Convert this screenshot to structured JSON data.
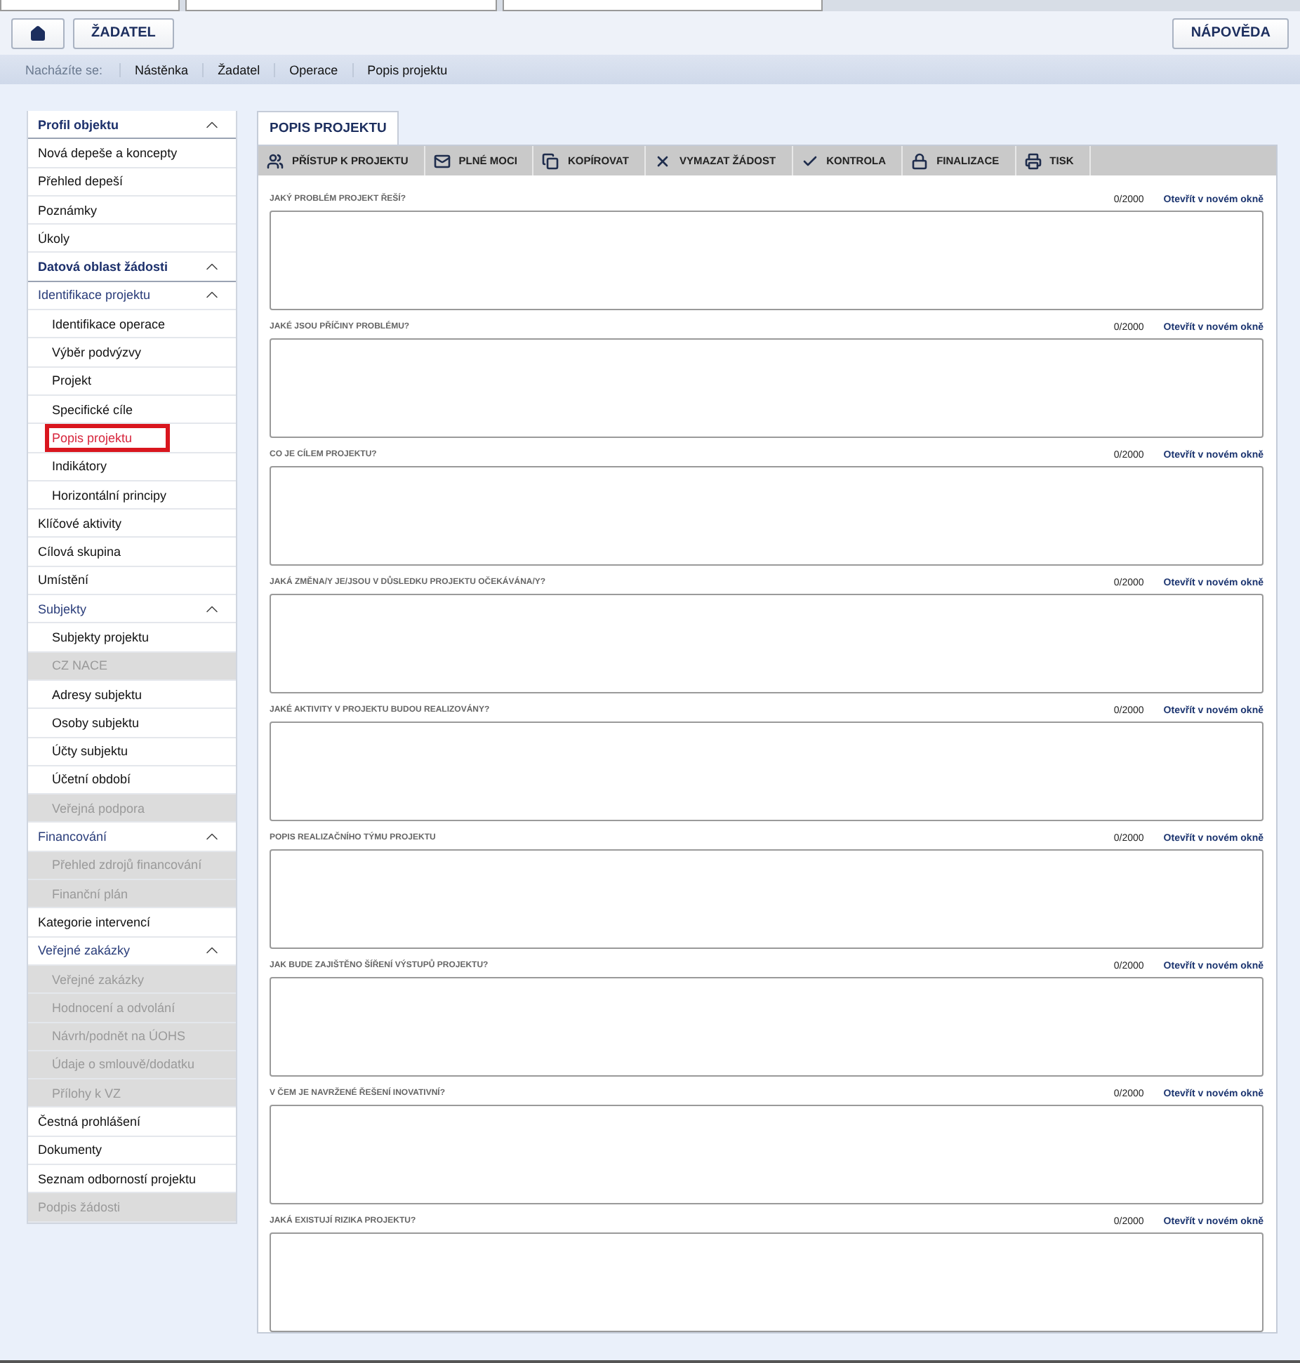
{
  "header": {
    "buttons": [
      {
        "label": "ŽADATEL"
      }
    ],
    "help_button": "NÁPOVĚDA"
  },
  "breadcrumb": {
    "prefix": "Nacházíte se:",
    "items": [
      "Nástěnka",
      "Žadatel",
      "Operace",
      "Popis projektu"
    ]
  },
  "sidebar": {
    "items": [
      {
        "kind": "section",
        "label": "Profil objektu",
        "expanded": true,
        "selected": false,
        "disabled": false,
        "children": [
          {
            "kind": "item",
            "label": "Nová depeše a koncepty",
            "selected": false,
            "disabled": false
          },
          {
            "kind": "item",
            "label": "Přehled depeší",
            "selected": false,
            "disabled": false
          },
          {
            "kind": "item",
            "label": "Poznámky",
            "selected": false,
            "disabled": false
          },
          {
            "kind": "item",
            "label": "Úkoly",
            "selected": false,
            "disabled": false
          }
        ]
      },
      {
        "kind": "section",
        "label": "Datová oblast žádosti",
        "expanded": true,
        "selected": false,
        "disabled": false,
        "children": [
          {
            "kind": "group",
            "label": "Identifikace projektu",
            "expanded": true,
            "selected": false,
            "disabled": false,
            "children": [
              {
                "kind": "item",
                "label": "Identifikace operace",
                "selected": false,
                "disabled": false
              },
              {
                "kind": "item",
                "label": "Výběr podvýzvy",
                "selected": false,
                "disabled": false
              },
              {
                "kind": "item",
                "label": "Projekt",
                "selected": false,
                "disabled": false
              },
              {
                "kind": "item",
                "label": "Specifické cíle",
                "selected": false,
                "disabled": false
              },
              {
                "kind": "item",
                "label": "Popis projektu",
                "selected": true,
                "disabled": false
              },
              {
                "kind": "item",
                "label": "Indikátory",
                "selected": false,
                "disabled": false
              },
              {
                "kind": "item",
                "label": "Horizontální principy",
                "selected": false,
                "disabled": false
              }
            ]
          },
          {
            "kind": "item",
            "label": "Klíčové aktivity",
            "selected": false,
            "disabled": false
          },
          {
            "kind": "item",
            "label": "Cílová skupina",
            "selected": false,
            "disabled": false
          },
          {
            "kind": "item",
            "label": "Umístění",
            "selected": false,
            "disabled": false
          },
          {
            "kind": "group",
            "label": "Subjekty",
            "expanded": true,
            "selected": false,
            "disabled": false,
            "children": [
              {
                "kind": "item",
                "label": "Subjekty projektu",
                "selected": false,
                "disabled": false
              },
              {
                "kind": "item",
                "label": "CZ NACE",
                "selected": false,
                "disabled": true
              },
              {
                "kind": "item",
                "label": "Adresy subjektu",
                "selected": false,
                "disabled": false
              },
              {
                "kind": "item",
                "label": "Osoby subjektu",
                "selected": false,
                "disabled": false
              },
              {
                "kind": "item",
                "label": "Účty subjektu",
                "selected": false,
                "disabled": false
              },
              {
                "kind": "item",
                "label": "Účetní období",
                "selected": false,
                "disabled": false
              },
              {
                "kind": "item",
                "label": "Veřejná podpora",
                "selected": false,
                "disabled": true
              }
            ]
          },
          {
            "kind": "group",
            "label": "Financování",
            "expanded": true,
            "selected": false,
            "disabled": false,
            "children": [
              {
                "kind": "item",
                "label": "Přehled zdrojů financování",
                "selected": false,
                "disabled": true
              },
              {
                "kind": "item",
                "label": "Finanční plán",
                "selected": false,
                "disabled": true
              }
            ]
          },
          {
            "kind": "item",
            "label": "Kategorie intervencí",
            "selected": false,
            "disabled": false
          },
          {
            "kind": "group",
            "label": "Veřejné zakázky",
            "expanded": true,
            "selected": false,
            "disabled": false,
            "children": [
              {
                "kind": "item",
                "label": "Veřejné zakázky",
                "selected": false,
                "disabled": true
              },
              {
                "kind": "item",
                "label": "Hodnocení a odvolání",
                "selected": false,
                "disabled": true
              },
              {
                "kind": "item",
                "label": "Návrh/podnět na ÚOHS",
                "selected": false,
                "disabled": true
              },
              {
                "kind": "item",
                "label": "Údaje o smlouvě/dodatku",
                "selected": false,
                "disabled": true
              },
              {
                "kind": "item",
                "label": "Přílohy k VZ",
                "selected": false,
                "disabled": true
              }
            ]
          },
          {
            "kind": "item",
            "label": "Čestná prohlášení",
            "selected": false,
            "disabled": false
          },
          {
            "kind": "item",
            "label": "Dokumenty",
            "selected": false,
            "disabled": false
          },
          {
            "kind": "item",
            "label": "Seznam odborností projektu",
            "selected": false,
            "disabled": false
          },
          {
            "kind": "item",
            "label": "Podpis žádosti",
            "selected": false,
            "disabled": true
          }
        ]
      }
    ]
  },
  "tabs": [
    {
      "label": "POPIS PROJEKTU",
      "selected": true
    }
  ],
  "toolbar": [
    {
      "kind": "people",
      "label": "PŘÍSTUP K PROJEKTU"
    },
    {
      "kind": "mail",
      "label": "PLNÉ MOCI"
    },
    {
      "kind": "copy",
      "label": "KOPÍROVAT"
    },
    {
      "kind": "delete",
      "label": "VYMAZAT ŽÁDOST"
    },
    {
      "kind": "check",
      "label": "KONTROLA"
    },
    {
      "kind": "lock",
      "label": "FINALIZACE"
    },
    {
      "kind": "print",
      "label": "TISK"
    }
  ],
  "fields": [
    {
      "label": "JAKÝ PROBLÉM PROJEKT ŘEŠÍ?",
      "counter": "0/2000",
      "link": "Otevřít v novém okně"
    },
    {
      "label": "JAKÉ JSOU PŘÍČINY PROBLÉMU?",
      "counter": "0/2000",
      "link": "Otevřít v novém okně"
    },
    {
      "label": "CO JE CÍLEM PROJEKTU?",
      "counter": "0/2000",
      "link": "Otevřít v novém okně"
    },
    {
      "label": "JAKÁ ZMĚNA/Y JE/JSOU V DŮSLEDKU PROJEKTU OČEKÁVÁNA/Y?",
      "counter": "0/2000",
      "link": "Otevřít v novém okně"
    },
    {
      "label": "JAKÉ AKTIVITY V PROJEKTU BUDOU REALIZOVÁNY?",
      "counter": "0/2000",
      "link": "Otevřít v novém okně"
    },
    {
      "label": "POPIS REALIZAČNÍHO TÝMU PROJEKTU",
      "counter": "0/2000",
      "link": "Otevřít v novém okně"
    },
    {
      "label": "JAK BUDE ZAJIŠTĚNO ŠÍŘENÍ VÝSTUPŮ PROJEKTU?",
      "counter": "0/2000",
      "link": "Otevřít v novém okně"
    },
    {
      "label": "V ČEM JE NAVRŽENÉ ŘEŠENÍ INOVATIVNÍ?",
      "counter": "0/2000",
      "link": "Otevřít v novém okně"
    },
    {
      "label": "JAKÁ EXISTUJÍ RIZIKA PROJEKTU?",
      "counter": "0/2000",
      "link": "Otevřít v novém okně"
    }
  ]
}
